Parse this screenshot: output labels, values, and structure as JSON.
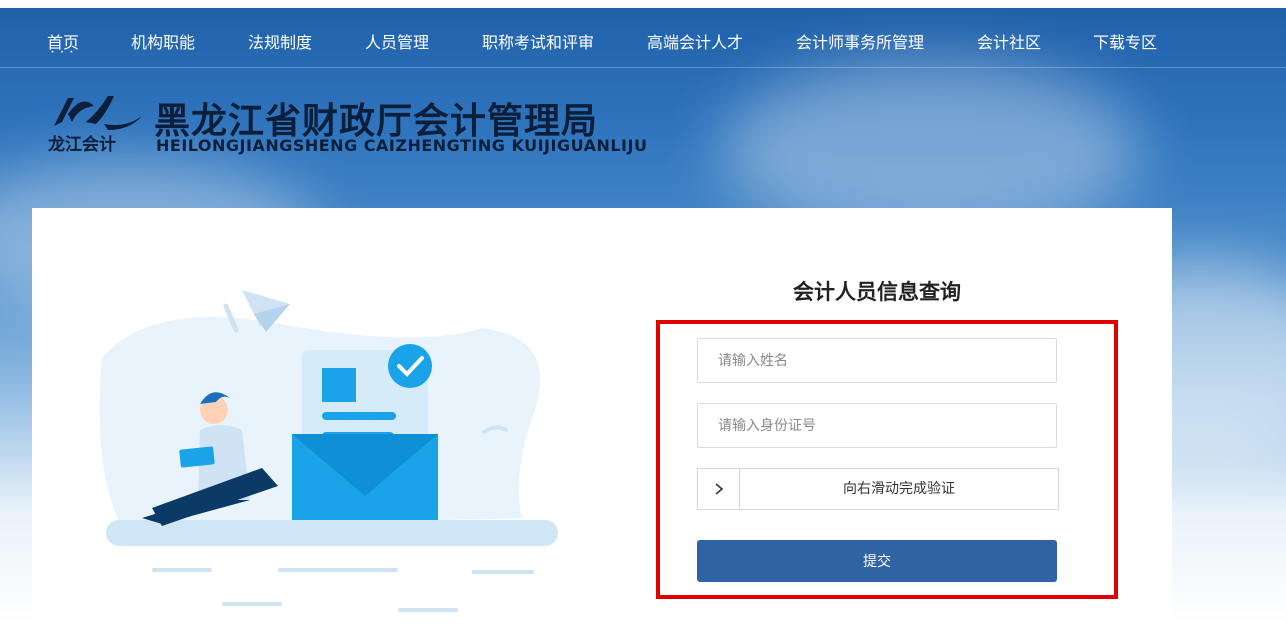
{
  "nav": {
    "items": [
      {
        "label": "首页",
        "active": true
      },
      {
        "label": "机构职能"
      },
      {
        "label": "法规制度"
      },
      {
        "label": "人员管理"
      },
      {
        "label": "职称考试和评审"
      },
      {
        "label": "高端会计人才"
      },
      {
        "label": "会计师事务所管理"
      },
      {
        "label": "会计社区"
      },
      {
        "label": "下载专区"
      }
    ]
  },
  "header": {
    "logo_text": "龙江会计",
    "title": "黑龙江省财政厅会计管理局",
    "subtitle": "HEILONGJIANGSHENG CAIZHENGTING KUIJIGUANLIJU"
  },
  "form": {
    "title": "会计人员信息查询",
    "name_placeholder": "请输入姓名",
    "id_placeholder": "请输入身份证号",
    "slider_text": "向右滑动完成验证",
    "submit_label": "提交"
  },
  "colors": {
    "nav_bg": "#1f5fa8",
    "submit_bg": "#2f63a3",
    "highlight": "#e00000",
    "illustration_blue": "#1aa3e8"
  },
  "icons": {
    "slider_handle": "chevron-right-icon",
    "illustration": "person-with-tablet-illustration"
  }
}
